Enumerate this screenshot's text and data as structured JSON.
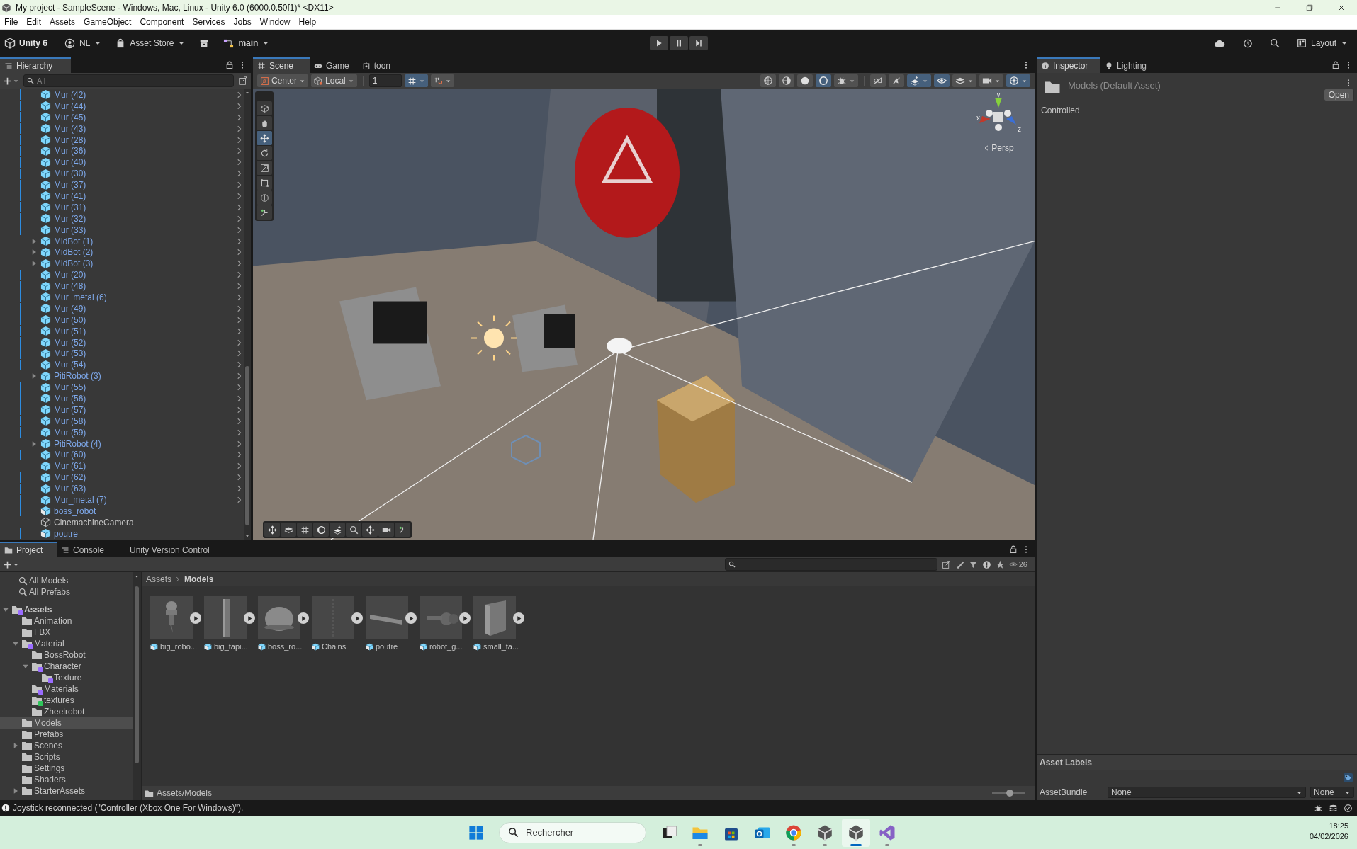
{
  "window": {
    "title": "My project - SampleScene - Windows, Mac, Linux - Unity 6.0 (6000.0.50f1)* <DX11>"
  },
  "menu": [
    "File",
    "Edit",
    "Assets",
    "GameObject",
    "Component",
    "Services",
    "Jobs",
    "Window",
    "Help"
  ],
  "toolbar": {
    "product": "Unity 6",
    "account": "NL",
    "store": "Asset Store",
    "branch": "main",
    "layout": "Layout"
  },
  "hierarchy": {
    "title": "Hierarchy",
    "search": {
      "placeholder": "All"
    },
    "items": [
      {
        "name": "Mur (42)",
        "kind": "prefab",
        "overridden": true,
        "has_children": false
      },
      {
        "name": "Mur (44)",
        "kind": "prefab",
        "overridden": true,
        "has_children": false
      },
      {
        "name": "Mur (45)",
        "kind": "prefab",
        "overridden": true,
        "has_children": false
      },
      {
        "name": "Mur (43)",
        "kind": "prefab",
        "overridden": true,
        "has_children": false
      },
      {
        "name": "Mur (28)",
        "kind": "prefab",
        "overridden": true,
        "has_children": false
      },
      {
        "name": "Mur (36)",
        "kind": "prefab",
        "overridden": true,
        "has_children": false
      },
      {
        "name": "Mur (40)",
        "kind": "prefab",
        "overridden": true,
        "has_children": false
      },
      {
        "name": "Mur (30)",
        "kind": "prefab",
        "overridden": true,
        "has_children": false
      },
      {
        "name": "Mur (37)",
        "kind": "prefab",
        "overridden": true,
        "has_children": false
      },
      {
        "name": "Mur (41)",
        "kind": "prefab",
        "overridden": true,
        "has_children": false
      },
      {
        "name": "Mur (31)",
        "kind": "prefab",
        "overridden": true,
        "has_children": false
      },
      {
        "name": "Mur (32)",
        "kind": "prefab",
        "overridden": true,
        "has_children": false
      },
      {
        "name": "Mur (33)",
        "kind": "prefab",
        "overridden": true,
        "has_children": false
      },
      {
        "name": "MidBot (1)",
        "kind": "prefab",
        "overridden": false,
        "has_children": true
      },
      {
        "name": "MidBot (2)",
        "kind": "prefab",
        "overridden": false,
        "has_children": true
      },
      {
        "name": "MidBot (3)",
        "kind": "prefab",
        "overridden": false,
        "has_children": true
      },
      {
        "name": "Mur (20)",
        "kind": "prefab",
        "overridden": true,
        "has_children": false
      },
      {
        "name": "Mur (48)",
        "kind": "prefab",
        "overridden": true,
        "has_children": false
      },
      {
        "name": "Mur_metal (6)",
        "kind": "prefab",
        "overridden": true,
        "has_children": false
      },
      {
        "name": "Mur (49)",
        "kind": "prefab",
        "overridden": true,
        "has_children": false
      },
      {
        "name": "Mur (50)",
        "kind": "prefab",
        "overridden": true,
        "has_children": false
      },
      {
        "name": "Mur (51)",
        "kind": "prefab",
        "overridden": true,
        "has_children": false
      },
      {
        "name": "Mur (52)",
        "kind": "prefab",
        "overridden": true,
        "has_children": false
      },
      {
        "name": "Mur (53)",
        "kind": "prefab",
        "overridden": true,
        "has_children": false
      },
      {
        "name": "Mur (54)",
        "kind": "prefab",
        "overridden": true,
        "has_children": false
      },
      {
        "name": "PitiRobot (3)",
        "kind": "prefab",
        "overridden": false,
        "has_children": true
      },
      {
        "name": "Mur (55)",
        "kind": "prefab",
        "overridden": true,
        "has_children": false
      },
      {
        "name": "Mur (56)",
        "kind": "prefab",
        "overridden": true,
        "has_children": false
      },
      {
        "name": "Mur (57)",
        "kind": "prefab",
        "overridden": true,
        "has_children": false
      },
      {
        "name": "Mur (58)",
        "kind": "prefab",
        "overridden": true,
        "has_children": false
      },
      {
        "name": "Mur (59)",
        "kind": "prefab",
        "overridden": true,
        "has_children": false
      },
      {
        "name": "PitiRobot (4)",
        "kind": "prefab",
        "overridden": false,
        "has_children": true
      },
      {
        "name": "Mur (60)",
        "kind": "prefab",
        "overridden": true,
        "has_children": false
      },
      {
        "name": "Mur (61)",
        "kind": "prefab",
        "overridden": false,
        "has_children": false
      },
      {
        "name": "Mur (62)",
        "kind": "prefab",
        "overridden": true,
        "has_children": false
      },
      {
        "name": "Mur (63)",
        "kind": "prefab",
        "overridden": true,
        "has_children": false
      },
      {
        "name": "Mur_metal (7)",
        "kind": "prefab",
        "overridden": true,
        "has_children": false
      },
      {
        "name": "boss_robot",
        "kind": "model",
        "overridden": true,
        "has_children": false
      },
      {
        "name": "CinemachineCamera",
        "kind": "object",
        "overridden": false,
        "has_children": false
      },
      {
        "name": "poutre",
        "kind": "model",
        "overridden": true,
        "has_children": false
      }
    ]
  },
  "scene": {
    "tabs": [
      {
        "label": "Scene",
        "kind": "scene",
        "selected": true
      },
      {
        "label": "Game",
        "kind": "game",
        "selected": false
      },
      {
        "label": "toon",
        "kind": "toon",
        "selected": false
      }
    ],
    "pivot": "Center",
    "space": "Local",
    "grid_size": "1",
    "snap_tools": [
      {
        "kind": "grid",
        "on": true
      },
      {
        "kind": "magnet",
        "on": false
      }
    ],
    "view_tools": [
      {
        "kind": "globe",
        "on": false,
        "dropdown": false
      },
      {
        "kind": "half",
        "on": false,
        "dropdown": false
      },
      {
        "kind": "solid",
        "on": false,
        "dropdown": false
      },
      {
        "kind": "ring",
        "on": true,
        "dropdown": false
      },
      {
        "kind": "bug",
        "on": false,
        "dropdown": true
      },
      {
        "kind": "flat",
        "on": false,
        "dropdown": false
      },
      {
        "kind": "speaker",
        "on": false,
        "dropdown": false
      },
      {
        "kind": "sparkle",
        "on": true,
        "dropdown": true
      },
      {
        "kind": "eye",
        "on": true,
        "dropdown": false
      },
      {
        "kind": "layers",
        "on": false,
        "dropdown": true
      },
      {
        "kind": "camera",
        "on": false,
        "dropdown": true
      },
      {
        "kind": "gizmo",
        "on": true,
        "dropdown": true
      }
    ],
    "tools": [
      {
        "kind": "view",
        "selected": false
      },
      {
        "kind": "hand",
        "selected": false
      },
      {
        "kind": "move",
        "selected": true
      },
      {
        "kind": "rotate",
        "selected": false
      },
      {
        "kind": "scale",
        "selected": false
      },
      {
        "kind": "rect",
        "selected": false
      },
      {
        "kind": "transform",
        "selected": false
      },
      {
        "kind": "custom",
        "selected": false
      }
    ],
    "gizmo": {
      "axes": [
        "y",
        "x",
        "z"
      ],
      "projection": "Persp"
    }
  },
  "project": {
    "tabs": [
      {
        "label": "Project",
        "selected": true
      },
      {
        "label": "Console",
        "selected": false
      },
      {
        "label": "Unity Version Control",
        "selected": false
      }
    ],
    "search_count": "26",
    "favorites": [
      "All Models",
      "All Prefabs"
    ],
    "tree": [
      {
        "name": "Assets",
        "expanded": true,
        "color": "#9a6cff",
        "selected": false,
        "children": [
          {
            "name": "Animation",
            "selected": false
          },
          {
            "name": "FBX",
            "selected": false
          },
          {
            "name": "Material",
            "expanded": true,
            "color": "#9a6cff",
            "selected": false,
            "children": [
              {
                "name": "BossRobot",
                "selected": false
              },
              {
                "name": "Character",
                "expanded": true,
                "color": "#9a6cff",
                "selected": false,
                "children": [
                  {
                    "name": "Texture",
                    "color": "#9a6cff",
                    "selected": false
                  }
                ]
              },
              {
                "name": "Materials",
                "color": "#9a6cff",
                "selected": false
              },
              {
                "name": "textures",
                "color": "#2fc45a",
                "selected": false
              },
              {
                "name": "Zheelrobot",
                "selected": false
              }
            ]
          },
          {
            "name": "Models",
            "selected": true
          },
          {
            "name": "Prefabs",
            "selected": false
          },
          {
            "name": "Scenes",
            "expanded": false,
            "selected": false
          },
          {
            "name": "Scripts",
            "selected": false
          },
          {
            "name": "Settings",
            "selected": false
          },
          {
            "name": "Shaders",
            "selected": false
          },
          {
            "name": "StarterAssets",
            "expanded": false,
            "selected": false
          }
        ]
      }
    ],
    "breadcrumb": [
      "Assets",
      "Models"
    ],
    "assets": [
      {
        "name": "big_robo...",
        "kind": "robot"
      },
      {
        "name": "big_tapi...",
        "kind": "pillar"
      },
      {
        "name": "boss_ro...",
        "kind": "sphere"
      },
      {
        "name": "Chains",
        "kind": "chain"
      },
      {
        "name": "poutre",
        "kind": "beam"
      },
      {
        "name": "robot_g...",
        "kind": "gun"
      },
      {
        "name": "small_ta...",
        "kind": "block"
      }
    ],
    "path": "Assets/Models",
    "zoom": {
      "level": 0.55
    }
  },
  "inspector": {
    "tabs": [
      {
        "label": "Inspector",
        "kind": "info",
        "selected": true
      },
      {
        "label": "Lighting",
        "kind": "bulb",
        "selected": false
      }
    ],
    "title": "Models (Default Asset)",
    "open_button": "Open",
    "status": "Controlled",
    "asset_labels": "Asset Labels",
    "asset_bundle": {
      "label": "AssetBundle",
      "name": "None",
      "variant": "None"
    }
  },
  "status_bar": {
    "message": "Joystick reconnected (\"Controller (Xbox One For Windows)\")."
  },
  "taskbar": {
    "search": {
      "placeholder": "Rechercher"
    },
    "apps": [
      {
        "kind": "task-view",
        "running": false,
        "selected": false
      },
      {
        "kind": "folder",
        "running": true,
        "selected": false
      },
      {
        "kind": "store",
        "running": false,
        "selected": false
      },
      {
        "kind": "mail",
        "running": false,
        "selected": false
      },
      {
        "kind": "browser",
        "running": true,
        "selected": false
      },
      {
        "kind": "hub",
        "running": true,
        "selected": false
      },
      {
        "kind": "editor",
        "running": true,
        "selected": true
      },
      {
        "kind": "ide",
        "running": true,
        "selected": false
      }
    ],
    "time": "18:25",
    "date": "04/02/2026"
  }
}
